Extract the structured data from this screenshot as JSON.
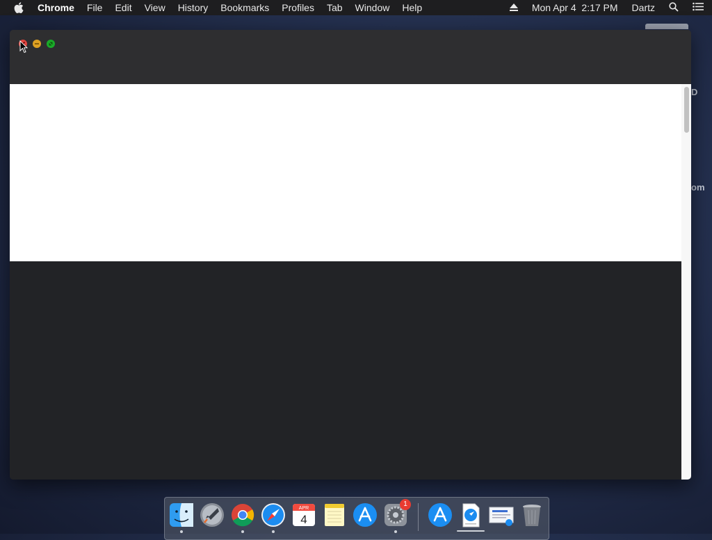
{
  "menubar": {
    "app_name": "Chrome",
    "menus": [
      "File",
      "Edit",
      "View",
      "History",
      "Bookmarks",
      "Profiles",
      "Tab",
      "Window",
      "Help"
    ],
    "datetime": "Mon Apr 4  2:17 PM",
    "user": "Dartz"
  },
  "desktop": {
    "partial_labels": [
      "D",
      "om"
    ]
  },
  "dock": {
    "items": [
      {
        "name": "Finder",
        "icon": "finder-icon"
      },
      {
        "name": "Launchpad",
        "icon": "launchpad-icon"
      },
      {
        "name": "Google Chrome",
        "icon": "chrome-icon"
      },
      {
        "name": "Safari",
        "icon": "safari-icon"
      },
      {
        "name": "Calendar",
        "icon": "calendar-icon",
        "month": "APR",
        "day": "4"
      },
      {
        "name": "Notes",
        "icon": "notes-icon"
      },
      {
        "name": "App Store",
        "icon": "app-store-icon"
      },
      {
        "name": "System Preferences",
        "icon": "system-preferences-icon",
        "badge": "1"
      },
      {
        "name": "App Store Installer",
        "icon": "app-store-icon"
      },
      {
        "name": "Downloads",
        "icon": "downloads-stack-icon"
      },
      {
        "name": "Document",
        "icon": "document-preview-icon"
      },
      {
        "name": "Trash",
        "icon": "trash-icon"
      }
    ]
  },
  "colors": {
    "close": "#e0443e",
    "minimize": "#dea123",
    "maximize": "#1aab29",
    "badge": "#e93b31"
  }
}
